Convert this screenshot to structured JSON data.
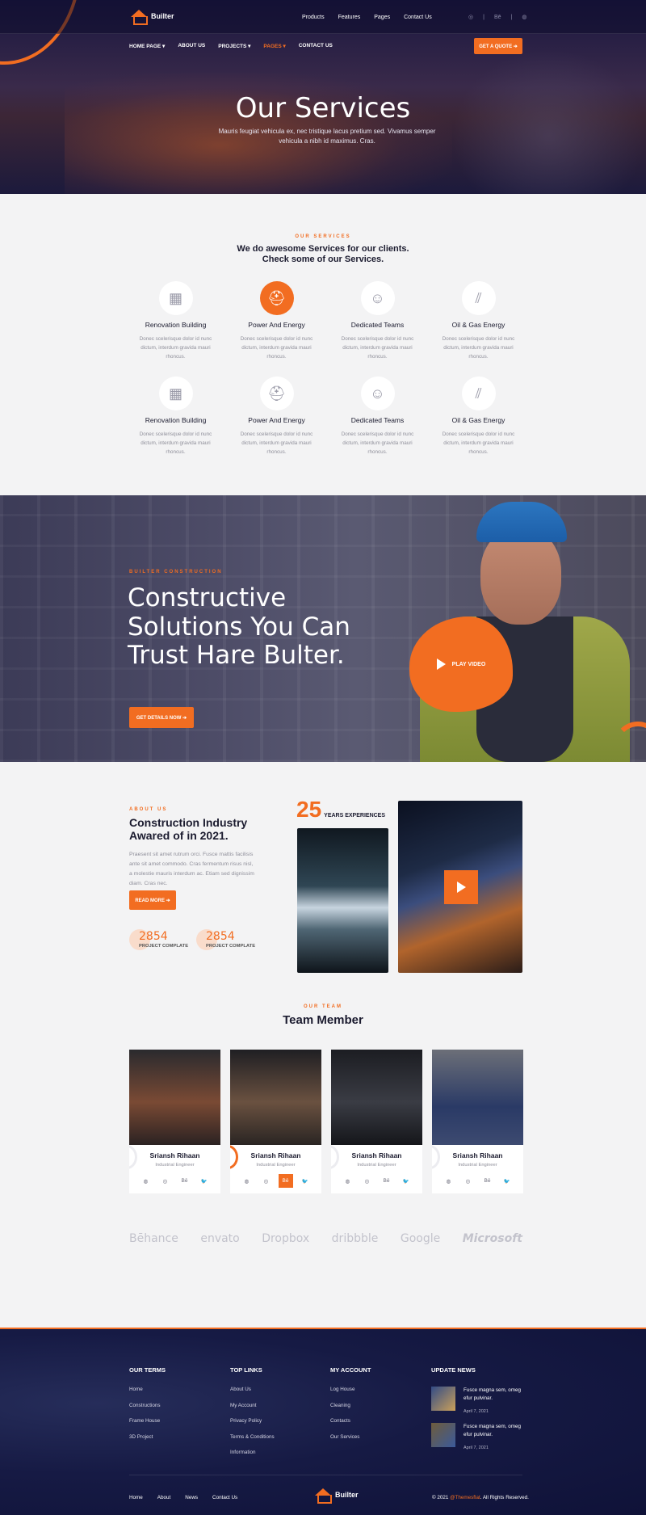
{
  "brand": {
    "name": "Builter"
  },
  "topnav": [
    "Products",
    "Features",
    "Pages",
    "Contact Us"
  ],
  "topsocial": [
    "◎",
    "|",
    "Bē",
    "|",
    "◍"
  ],
  "mainnav": [
    {
      "label": "HOME PAGE ▾"
    },
    {
      "label": "ABOUT US"
    },
    {
      "label": "PROJECTS ▾"
    },
    {
      "label": "PAGES ▾"
    },
    {
      "label": "CONTACT US"
    }
  ],
  "quote_btn": "GET A QUOTE ➔",
  "hero": {
    "title": "Our Services",
    "text": "Mauris feugiat vehicula ex, nec tristique lacus pretium sed. Vivamus semper vehicula a nibh id maximus. Cras."
  },
  "services": {
    "eyebrow": "OUR SERVICES",
    "title_line1": "We do awesome Services for our clients.",
    "title_line2": "Check some of our Services.",
    "items": [
      {
        "title": "Renovation Building",
        "text": "Donec scelerisque dolor id nunc dictum, interdum gravida mauri rhoncus."
      },
      {
        "title": "Power And Energy",
        "text": "Donec scelerisque dolor id nunc dictum, interdum gravida mauri rhoncus."
      },
      {
        "title": "Dedicated Teams",
        "text": "Donec scelerisque dolor id nunc dictum, interdum gravida mauri rhoncus."
      },
      {
        "title": "Oil & Gas Energy",
        "text": "Donec scelerisque dolor id nunc dictum, interdum gravida mauri rhoncus."
      },
      {
        "title": "Renovation Building",
        "text": "Donec scelerisque dolor id nunc dictum, interdum gravida mauri rhoncus."
      },
      {
        "title": "Power And Energy",
        "text": "Donec scelerisque dolor id nunc dictum, interdum gravida mauri rhoncus."
      },
      {
        "title": "Dedicated Teams",
        "text": "Donec scelerisque dolor id nunc dictum, interdum gravida mauri rhoncus."
      },
      {
        "title": "Oil & Gas Energy",
        "text": "Donec scelerisque dolor id nunc dictum, interdum gravida mauri rhoncus."
      }
    ]
  },
  "cta": {
    "eyebrow": "BUILTER CONSTRUCTION",
    "line1": "Constructive",
    "line2": "Solutions You Can",
    "line3": "Trust Hare Bulter.",
    "button": "GET DETAILS NOW ➔",
    "play": "PLAY VIDEO"
  },
  "about": {
    "eyebrow": "ABOUT US",
    "title": "Construction Industry Awared of in 2021.",
    "text": "Praesent sit amet rutrum orci. Fusce mattis facilisis ante sit amet commodo. Cras fermentum risus nisl, a molestie mauris interdum ac. Etiam sed dignissim diam. Cras nec.",
    "button": "READ MORE ➔",
    "years": "25",
    "years_label": "YEARS EXPERIENCES",
    "counters": [
      {
        "n": "2854",
        "l": "PROJECT COMPLATE"
      },
      {
        "n": "2854",
        "l": "PROJECT COMPLATE"
      }
    ]
  },
  "team": {
    "eyebrow": "OUR TEAM",
    "title": "Team Member",
    "members": [
      {
        "name": "Sriansh Rihaan",
        "role": "Industrial Engineer"
      },
      {
        "name": "Sriansh Rihaan",
        "role": "Industrial Engineer"
      },
      {
        "name": "Sriansh Rihaan",
        "role": "Industrial Engineer"
      },
      {
        "name": "Sriansh Rihaan",
        "role": "Industrial Engineer"
      }
    ],
    "social": [
      "◍",
      "◎",
      "Bē",
      "🐦"
    ]
  },
  "brands": [
    "Bēhance",
    "envato",
    "Dropbox",
    "dribbble",
    "Google",
    "Microsoft"
  ],
  "footer": {
    "col1": {
      "title": "OUR TERMS",
      "links": [
        "Home",
        "Constructions",
        "Frame House",
        "3D Project"
      ]
    },
    "col2": {
      "title": "TOP LINKS",
      "links": [
        "About Us",
        "My Account",
        "Privacy Policy",
        "Terms & Conditions",
        "Information"
      ]
    },
    "col3": {
      "title": "MY ACCOUNT",
      "links": [
        "Log House",
        "Cleaning",
        "Contacts",
        "Our Services"
      ]
    },
    "col4": {
      "title": "UPDATE NEWS",
      "news": [
        {
          "text": "Fusce magna sem, omeg efur pulvinar.",
          "date": "April 7, 2021"
        },
        {
          "text": "Fusce magna sem, omeg efur pulvinar.",
          "date": "April 7, 2021"
        }
      ]
    },
    "bottom": [
      "Home",
      "About",
      "News",
      "Contact Us"
    ],
    "copy_pre": "© 2021 ",
    "copy_brand": "@Themesflat",
    "copy_post": ". All Rights Reserved."
  },
  "colors": {
    "accent": "#f26d21",
    "navy": "#161a44"
  }
}
